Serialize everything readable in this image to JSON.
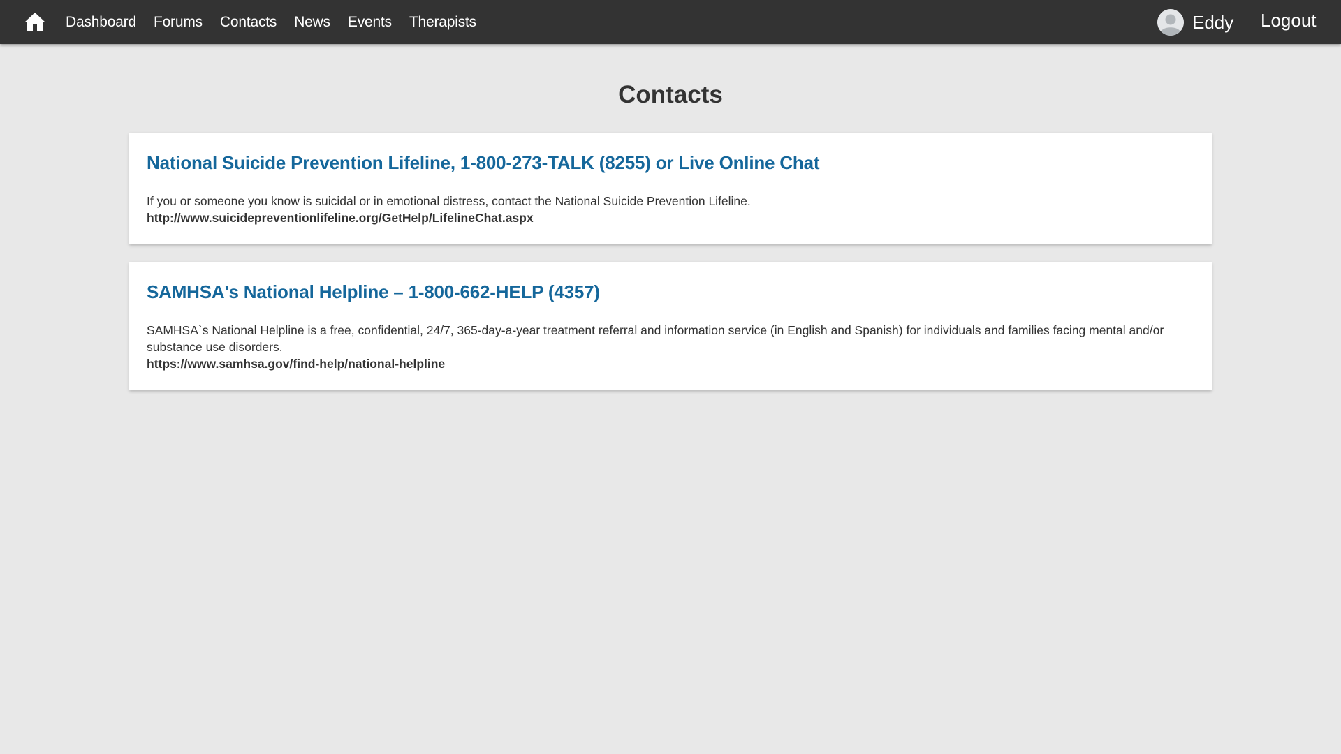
{
  "navbar": {
    "home_icon": "home-icon",
    "links": [
      {
        "label": "Dashboard"
      },
      {
        "label": "Forums"
      },
      {
        "label": "Contacts"
      },
      {
        "label": "News"
      },
      {
        "label": "Events"
      },
      {
        "label": "Therapists"
      }
    ],
    "user": {
      "name": "Eddy",
      "avatar_icon": "user-avatar-icon"
    },
    "logout_label": "Logout"
  },
  "page": {
    "title": "Contacts"
  },
  "contacts": [
    {
      "title": "National Suicide Prevention Lifeline, 1-800-273-TALK (8255) or Live Online Chat",
      "description": "If you or someone you know is suicidal or in emotional distress, contact the National Suicide Prevention Lifeline.",
      "link": "http://www.suicidepreventionlifeline.org/GetHelp/LifelineChat.aspx"
    },
    {
      "title": "SAMHSA's National Helpline – 1-800-662-HELP (4357)",
      "description": "SAMHSA`s National Helpline is a free, confidential, 24/7, 365-day-a-year treatment referral and information service (in English and Spanish) for individuals and families facing mental and/or substance use disorders.",
      "link": "https://www.samhsa.gov/find-help/national-helpline"
    }
  ],
  "colors": {
    "navbar_bg": "#333333",
    "page_bg": "#e8e8e8",
    "card_title": "#15679b",
    "text": "#333333"
  }
}
